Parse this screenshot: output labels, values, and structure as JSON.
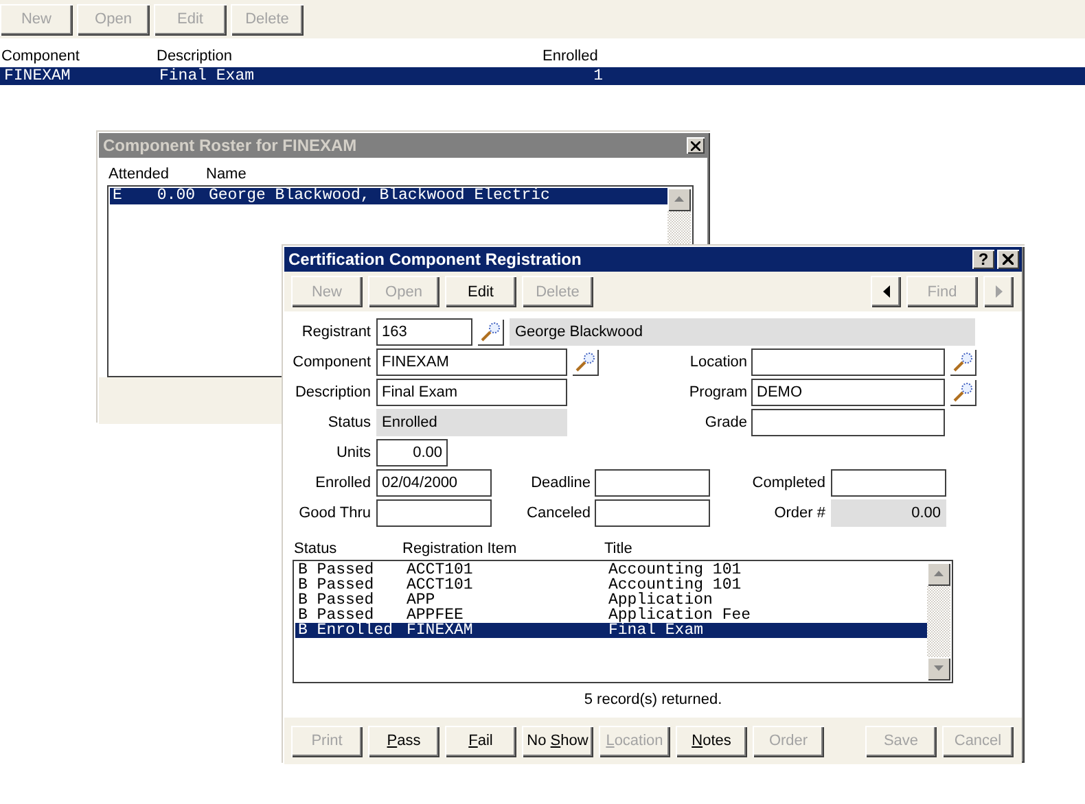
{
  "main_toolbar": [
    {
      "label": "New",
      "disabled": true
    },
    {
      "label": "Open",
      "disabled": true
    },
    {
      "label": "Edit",
      "disabled": true
    },
    {
      "label": "Delete",
      "disabled": true
    }
  ],
  "main_list": {
    "columns": [
      "Component",
      "Description",
      "Enrolled"
    ],
    "rows": [
      {
        "cells": [
          "FINEXAM",
          "Final Exam",
          "1"
        ],
        "selected": true
      }
    ]
  },
  "roster_window": {
    "title": "Component Roster for FINEXAM",
    "active": false,
    "headings": {
      "attended": "Attended",
      "name": "Name"
    },
    "entries": [
      {
        "code": "E",
        "hours": "0.00",
        "name": "George Blackwood, Blackwood Electric",
        "selected": true
      }
    ]
  },
  "registration_window": {
    "title": "Certification Component Registration",
    "active": true,
    "help_label": "?",
    "toolbar": [
      {
        "label": "New",
        "disabled": true
      },
      {
        "label": "Open",
        "disabled": true
      },
      {
        "label": "Edit",
        "disabled": false
      },
      {
        "label": "Delete",
        "disabled": true
      }
    ],
    "prev_disabled": false,
    "find": {
      "label": "Find",
      "disabled": true
    },
    "next_disabled": true,
    "form": {
      "registrant": {
        "label": "Registrant",
        "value": "163",
        "display": "George Blackwood"
      },
      "component": {
        "label": "Component",
        "value": "FINEXAM"
      },
      "location": {
        "label": "Location"
      },
      "description": {
        "label": "Description",
        "value": "Final Exam"
      },
      "program": {
        "label": "Program",
        "value": "DEMO"
      },
      "status": {
        "label": "Status",
        "value": "Enrolled"
      },
      "grade": {
        "label": "Grade"
      },
      "units": {
        "label": "Units",
        "value": "0.00"
      },
      "enrolled": {
        "label": "Enrolled",
        "value": "02/04/2000"
      },
      "deadline": {
        "label": "Deadline"
      },
      "completed": {
        "label": "Completed"
      },
      "good_thru": {
        "label": "Good Thru"
      },
      "canceled": {
        "label": "Canceled"
      },
      "order": {
        "label": "Order #",
        "value": "0.00"
      }
    },
    "list": {
      "columns": [
        "Status",
        "Registration Item",
        "Title"
      ],
      "rows": [
        {
          "cells": [
            "B Passed",
            "ACCT101",
            "Accounting 101"
          ],
          "selected": false
        },
        {
          "cells": [
            "B Passed",
            "ACCT101",
            "Accounting 101"
          ],
          "selected": false
        },
        {
          "cells": [
            "B Passed",
            "APP",
            "Application"
          ],
          "selected": false
        },
        {
          "cells": [
            "B Passed",
            "APPFEE",
            "Application Fee"
          ],
          "selected": false
        },
        {
          "cells": [
            "B Enrolled",
            "FINEXAM",
            "Final Exam"
          ],
          "selected": true
        }
      ]
    },
    "status_text": "5 record(s) returned.",
    "buttons": [
      {
        "parts": [
          {
            "text": "Print",
            "underline": false
          }
        ],
        "disabled": true
      },
      {
        "parts": [
          {
            "text": "P",
            "underline": true
          },
          {
            "text": "ass",
            "underline": false
          }
        ],
        "disabled": false
      },
      {
        "parts": [
          {
            "text": "F",
            "underline": true
          },
          {
            "text": "ail",
            "underline": false
          }
        ],
        "disabled": false
      },
      {
        "parts": [
          {
            "text": "No ",
            "underline": false
          },
          {
            "text": "S",
            "underline": true
          },
          {
            "text": "how",
            "underline": false
          }
        ],
        "disabled": false
      },
      {
        "parts": [
          {
            "text": "L",
            "underline": true
          },
          {
            "text": "ocation",
            "underline": false
          }
        ],
        "disabled": true
      },
      {
        "parts": [
          {
            "text": "N",
            "underline": true
          },
          {
            "text": "otes",
            "underline": false
          }
        ],
        "disabled": false
      },
      {
        "parts": [
          {
            "text": "Order",
            "underline": false
          }
        ],
        "disabled": true
      }
    ],
    "buttons_right": [
      {
        "parts": [
          {
            "text": "Save",
            "underline": false
          }
        ],
        "disabled": true
      },
      {
        "parts": [
          {
            "text": "Cancel",
            "underline": false
          }
        ],
        "disabled": true
      }
    ]
  }
}
